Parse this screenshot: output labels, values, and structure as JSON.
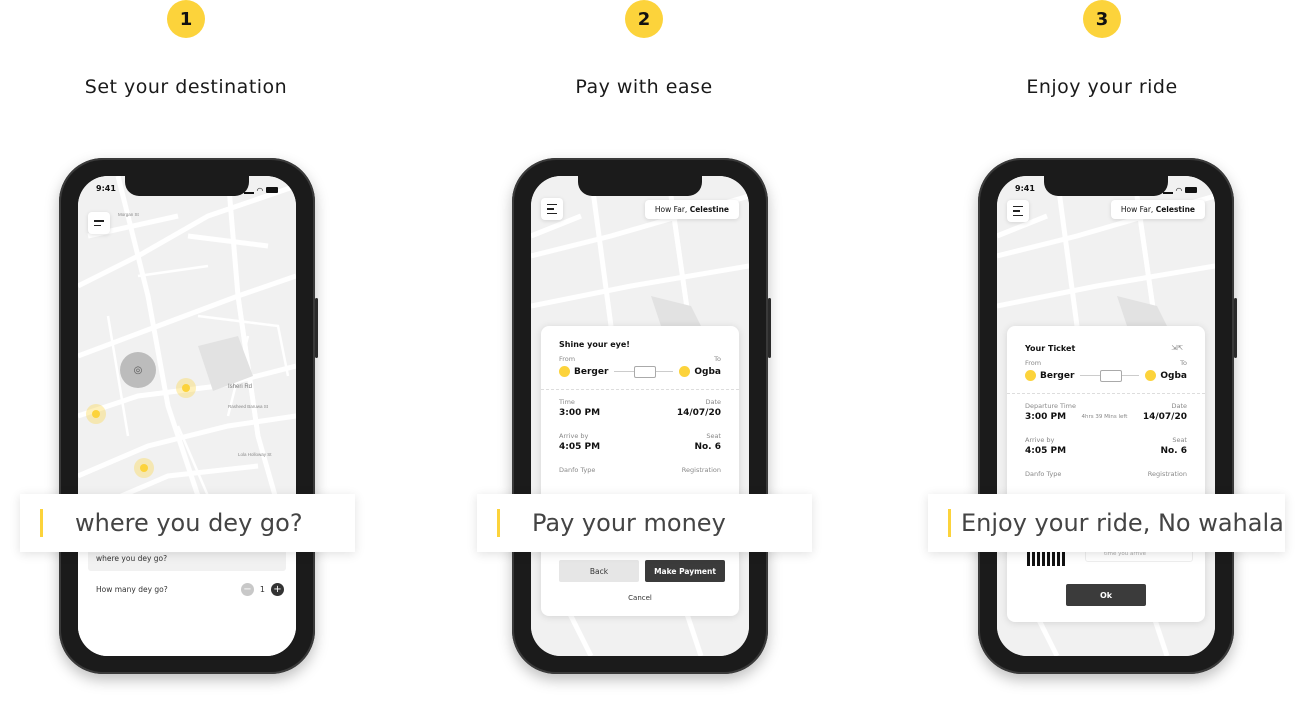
{
  "steps": [
    {
      "number": "1",
      "title": "Set your destination",
      "caption": "where you dey go?"
    },
    {
      "number": "2",
      "title": "Pay with ease",
      "caption": "Pay your money"
    },
    {
      "number": "3",
      "title": "Enjoy your ride",
      "caption": "Enjoy your ride, No wahala"
    }
  ],
  "phone1": {
    "time": "9:41",
    "input": "where you dey go?",
    "count_label": "How many dey go?",
    "count": "1",
    "streets": [
      "Isheri Rd",
      "Rasheed Baruwa St",
      "Lola Holloway St",
      "Ajibola St",
      "Tijani Bello St",
      "Morgan St"
    ]
  },
  "phone2": {
    "greeting_prefix": "How Far,",
    "greeting_name": "Celestine",
    "card_title": "Shine your eye!",
    "from_label": "From",
    "to_label": "To",
    "from": "Berger",
    "to": "Ogba",
    "time_label": "Time",
    "date_label": "Date",
    "time": "3:00 PM",
    "date": "14/07/20",
    "arrive_label": "Arrive by",
    "seat_label": "Seat",
    "arrive": "4:05 PM",
    "seat": "No. 6",
    "type_label": "Danfo Type",
    "reg_label": "Registration",
    "back": "Back",
    "pay": "Make Payment",
    "cancel": "Cancel"
  },
  "phone3": {
    "time": "9:41",
    "greeting_prefix": "How Far,",
    "greeting_name": "Celestine",
    "card_title": "Your Ticket",
    "from_label": "From",
    "to_label": "To",
    "from": "Berger",
    "to": "Ogba",
    "dep_label": "Departure Time",
    "date_label": "Date",
    "dep": "3:00 PM",
    "left": "4hrs 39 Mins left",
    "date": "14/07/20",
    "arrive_label": "Arrive by",
    "seat_label": "Seat",
    "arrive": "4:05 PM",
    "seat": "No. 6",
    "type_label": "Danfo Type",
    "reg_label": "Registration",
    "qr_note": "time you arrive",
    "ok": "Ok"
  },
  "colors": {
    "accent": "#fcd33b",
    "dark_button": "#3b3b3b",
    "map": "#f1f1f1"
  }
}
